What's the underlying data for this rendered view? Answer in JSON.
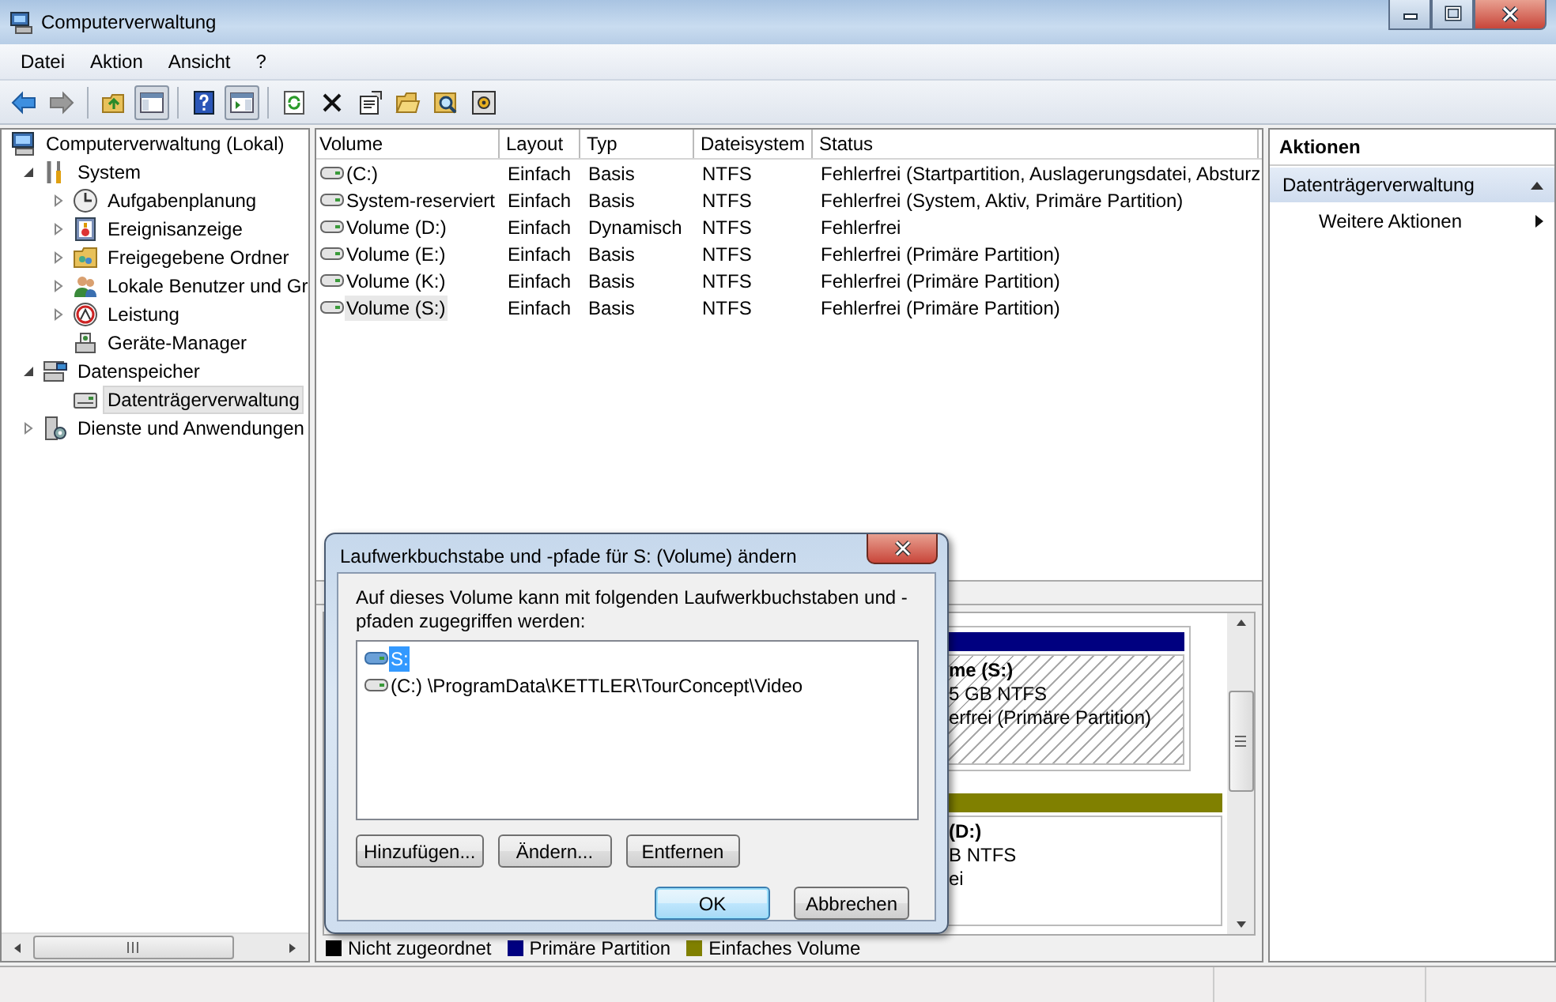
{
  "window": {
    "title": "Computerverwaltung"
  },
  "menu": [
    "Datei",
    "Aktion",
    "Ansicht",
    "?"
  ],
  "tree": [
    {
      "label": "Computerverwaltung (Lokal)",
      "selected": false,
      "children": [
        {
          "label": "System",
          "expanded": true,
          "selected": false,
          "children": [
            {
              "label": "Aufgabenplanung",
              "expanded": false,
              "selected": false
            },
            {
              "label": "Ereignisanzeige",
              "expanded": false,
              "selected": false
            },
            {
              "label": "Freigegebene Ordner",
              "expanded": false,
              "selected": false
            },
            {
              "label": "Lokale Benutzer und Gr",
              "expanded": false,
              "selected": false
            },
            {
              "label": "Leistung",
              "expanded": false,
              "selected": false
            },
            {
              "label": "Geräte-Manager",
              "selected": false
            }
          ]
        },
        {
          "label": "Datenspeicher",
          "expanded": true,
          "selected": false,
          "children": [
            {
              "label": "Datenträgerverwaltung",
              "selected": true
            }
          ]
        },
        {
          "label": "Dienste und Anwendungen",
          "expanded": false,
          "selected": false
        }
      ]
    }
  ],
  "table": {
    "columns": [
      "Volume",
      "Layout",
      "Typ",
      "Dateisystem",
      "Status"
    ],
    "rows": [
      {
        "selected": false,
        "cells": [
          " (C:)",
          "Einfach",
          "Basis",
          "NTFS",
          "Fehlerfrei (Startpartition, Auslagerungsdatei, Absturz"
        ]
      },
      {
        "selected": false,
        "cells": [
          "System-reserviert",
          "Einfach",
          "Basis",
          "NTFS",
          "Fehlerfrei (System, Aktiv, Primäre Partition)"
        ]
      },
      {
        "selected": false,
        "cells": [
          "Volume (D:)",
          "Einfach",
          "Dynamisch",
          "NTFS",
          "Fehlerfrei"
        ]
      },
      {
        "selected": false,
        "cells": [
          "Volume (E:)",
          "Einfach",
          "Basis",
          "NTFS",
          "Fehlerfrei (Primäre Partition)"
        ]
      },
      {
        "selected": false,
        "cells": [
          "Volume (K:)",
          "Einfach",
          "Basis",
          "NTFS",
          "Fehlerfrei (Primäre Partition)"
        ]
      },
      {
        "selected": true,
        "cells": [
          "Volume (S:)",
          "Einfach",
          "Basis",
          "NTFS",
          "Fehlerfrei (Primäre Partition)"
        ]
      }
    ]
  },
  "disks": [
    {
      "color": "#000080",
      "selected": true,
      "lines": [
        "me  (S:)",
        "5 GB NTFS",
        "erfrei (Primäre Partition)"
      ]
    },
    {
      "color": "#808000",
      "selected": false,
      "lines": [
        "(D:)",
        "B NTFS",
        "ei"
      ]
    }
  ],
  "legend": [
    {
      "label": "Nicht zugeordnet",
      "color": "#000000"
    },
    {
      "label": "Primäre Partition",
      "color": "#000080"
    },
    {
      "label": "Einfaches Volume",
      "color": "#808000"
    }
  ],
  "actions": {
    "title": "Aktionen",
    "section": {
      "label": "Datenträgerverwaltung",
      "expanded": true
    },
    "items": [
      "Weitere Aktionen"
    ]
  },
  "dialog": {
    "title": "Laufwerkbuchstabe und -pfade für S: (Volume) ändern",
    "description": "Auf dieses Volume kann mit folgenden Laufwerkbuchstaben und -pfaden zugegriffen werden:",
    "paths": [
      {
        "label": "S:",
        "selected": true
      },
      {
        "label": "(C:) \\ProgramData\\KETTLER\\TourConcept\\Video",
        "selected": false
      }
    ],
    "path_buttons": [
      "Hinzufügen...",
      "Ändern...",
      "Entfernen"
    ],
    "buttons": [
      {
        "label": "OK",
        "default": true
      },
      {
        "label": "Abbrechen",
        "default": false
      }
    ]
  }
}
